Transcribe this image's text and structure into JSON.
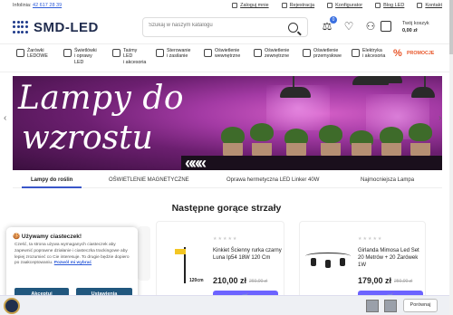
{
  "topbar": {
    "info_label": "Infolinia:",
    "phone": "42 617 28 39",
    "links": [
      "Zaloguj mnie",
      "Rejestracja",
      "Konfigurator",
      "Blog LED",
      "Kontakt"
    ]
  },
  "header": {
    "logo": "SMD-LED",
    "search_placeholder": "Szukaj w naszym katalogu",
    "compare_count": "0",
    "cart_label": "Twój koszyk",
    "cart_total": "0,00 zł"
  },
  "categories": [
    {
      "l1": "Żarówki",
      "l2": "LEDOWE",
      "l3": ""
    },
    {
      "l1": "Świetlówki",
      "l2": "i oprawy",
      "l3": "LED"
    },
    {
      "l1": "Taśmy",
      "l2": "LED",
      "l3": "i akcesoria"
    },
    {
      "l1": "Sterowanie",
      "l2": "i zasilanie",
      "l3": ""
    },
    {
      "l1": "Oświetlenie",
      "l2": "wewnętrzne",
      "l3": ""
    },
    {
      "l1": "Oświetlenie",
      "l2": "zewnętrzne",
      "l3": ""
    },
    {
      "l1": "Oświetlenie",
      "l2": "przemysłowe",
      "l3": ""
    },
    {
      "l1": "Elektryka",
      "l2": "i akcesoria",
      "l3": ""
    },
    {
      "l1": "PROMOCJE",
      "l2": "",
      "l3": ""
    }
  ],
  "hero": {
    "line1": "Lampy do",
    "line2": "wzrostu"
  },
  "tabs": [
    "Lampy do roślin",
    "OŚWIETLENIE MAGNETYCZNE",
    "Oprawa hermetyczna LED Linker 40W",
    "Najmocniejsza Lampa"
  ],
  "section_title": "Następne gorące strzały",
  "products": [
    {
      "title": "Kinkiet Ścienny rurka czarny Luna Ip54 18W 120 Cm",
      "price": "210,00 zł",
      "old_price": "260,00 zł",
      "image_label": "120cm"
    },
    {
      "title": "Girlanda Mimosa Led Set 20 Metrów + 20 Żarówek 1W",
      "price": "179,00 zł",
      "old_price": "250,00 zł"
    }
  ],
  "cookie": {
    "title": "🍪 Używamy ciasteczek!",
    "body": "Cześć, ta strona używa wymaganych ciasteczek aby zapewnić poprawne działanie i ciasteczka trackingowe aby lepiej zrozumieć co Cie interesuje. To drugie będzie dopiero po zaakceptowaniu.",
    "more_link": "Pozwól mi wybrać",
    "accept": "Akceptuj",
    "settings": "Ustawienia"
  },
  "compare_bar": {
    "button": "Porównaj"
  },
  "colors": {
    "accent": "#3a56c9",
    "buy_button": "#6c63ff",
    "cookie_button": "#21577e",
    "promo": "#e8572a"
  }
}
